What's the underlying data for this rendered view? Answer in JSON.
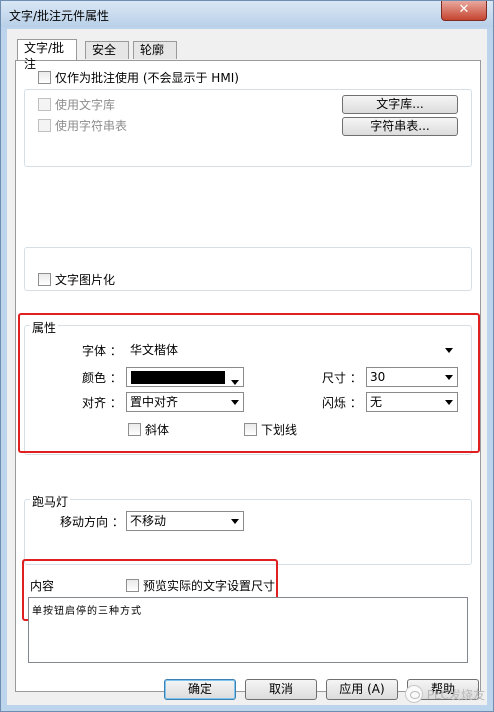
{
  "window": {
    "title": "文字/批注元件属性",
    "close_glyph": "✕"
  },
  "tabs": [
    {
      "label": "文字/批注",
      "active": true
    },
    {
      "label": "安全",
      "active": false
    },
    {
      "label": "轮廓",
      "active": false
    }
  ],
  "note_only": {
    "label": "仅作为批注使用 (不会显示于 HMI)",
    "checked": false
  },
  "text_source": {
    "use_library": {
      "label": "使用文字库",
      "checked": false,
      "enabled": false
    },
    "use_string_table": {
      "label": "使用字符串表",
      "checked": false,
      "enabled": false
    },
    "library_button": "文字库...",
    "string_table_button": "字符串表..."
  },
  "imageize": {
    "label": "文字图片化",
    "checked": false
  },
  "attributes": {
    "title": "属性",
    "font_label": "字体 ：",
    "font_value": "华文楷体",
    "color_label": "颜色 ：",
    "color_value": "#000000",
    "size_label": "尺寸 ：",
    "size_value": "30",
    "align_label": "对齐 ：",
    "align_value": "置中对齐",
    "blink_label": "闪烁 ：",
    "blink_value": "无",
    "italic": {
      "label": "斜体",
      "checked": false
    },
    "underline": {
      "label": "下划线",
      "checked": false
    }
  },
  "marquee": {
    "title": "跑马灯",
    "direction_label": "移动方向 ：",
    "direction_value": "不移动"
  },
  "content": {
    "title": "内容",
    "preview": {
      "label": "预览实际的文字设置尺寸",
      "checked": false
    },
    "text": "单按钮启停的三种方式"
  },
  "buttons": {
    "ok": "确定",
    "cancel": "取消",
    "apply": "应用 (A)",
    "help": "帮助"
  },
  "watermark": "PLC发烧友",
  "colors": {
    "highlight": "#e02020",
    "swatch": "#000000"
  }
}
